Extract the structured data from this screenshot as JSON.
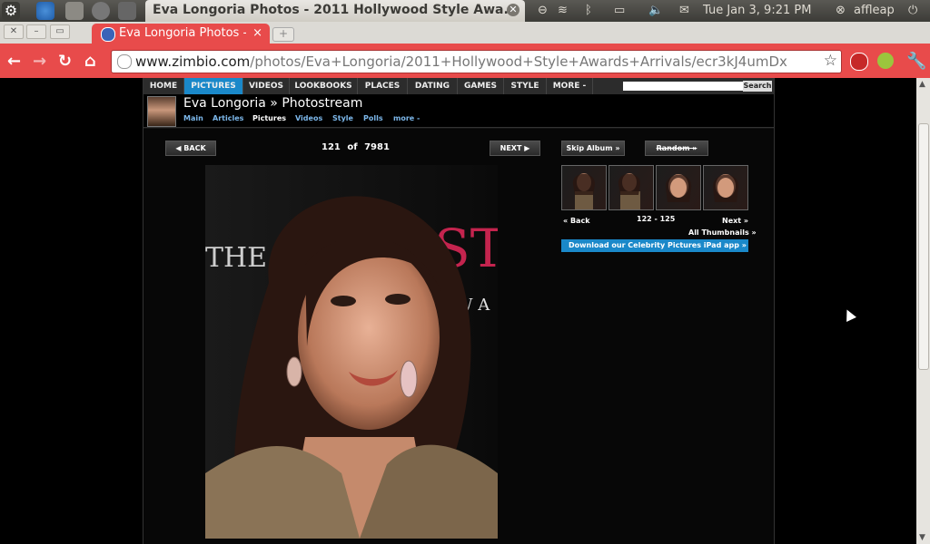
{
  "os_panel": {
    "window_title": "Eva Longoria Photos - 2011 Hollywood Style Awa...",
    "clock": "Tue Jan  3,  9:21 PM",
    "user": "affleap"
  },
  "browser": {
    "tab_title": "Eva Longoria Photos - 2",
    "url_host": "www.zimbio.com",
    "url_path": "/photos/Eva+Longoria/2011+Hollywood+Style+Awards+Arrivals/ecr3kJ4umDx"
  },
  "site_nav": {
    "items": [
      "HOME",
      "PICTURES",
      "VIDEOS",
      "LOOKBOOKS",
      "PLACES",
      "DATING",
      "GAMES",
      "STYLE",
      "MORE -"
    ],
    "active": "PICTURES",
    "search_button": "Search"
  },
  "celeb": {
    "name": "Eva Longoria",
    "sep": "»",
    "section": "Photostream",
    "subnav": [
      "Main",
      "Articles",
      "Pictures",
      "Videos",
      "Style",
      "Polls",
      "more -"
    ],
    "current_subnav": "Pictures"
  },
  "viewer": {
    "back": "◀ BACK",
    "next": "NEXT ▶",
    "index": "121",
    "of": "of",
    "total": "7981",
    "skip_album": "Skip Album »",
    "random": "Random »",
    "thumb_back": "« Back",
    "thumb_range": "122 - 125",
    "thumb_next": "Next »",
    "all_thumbnails": "All Thumbnails »",
    "ipad_promo": "Download our Celebrity Pictures iPad app »"
  },
  "photo_backdrop": {
    "left_text": "THE",
    "right_text": "ST",
    "right_sub": "W A"
  },
  "colors": {
    "browser_red": "#e84b4b",
    "active_blue": "#1a88c9"
  }
}
